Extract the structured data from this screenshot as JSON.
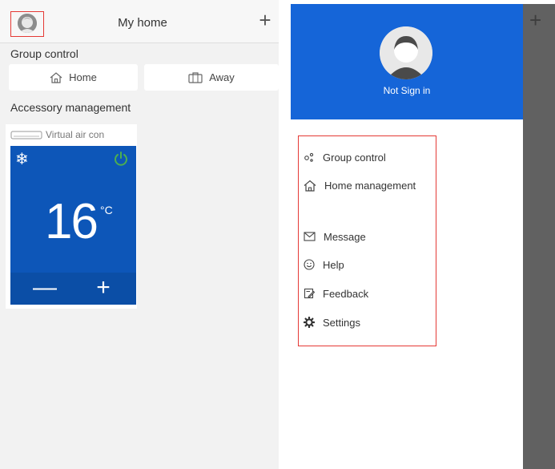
{
  "left_panel": {
    "title": "My home",
    "add_glyph": "+",
    "group_control_label": "Group control",
    "modes": [
      {
        "label": "Home",
        "icon": "home-icon"
      },
      {
        "label": "Away",
        "icon": "suitcase-icon"
      }
    ],
    "accessory_label": "Accessory management",
    "device": {
      "name": "Virtual air con",
      "temperature": "16",
      "unit": "°C",
      "minus": "—",
      "plus": "+",
      "mode_icon": "snowflake-icon",
      "power_icon": "power-icon",
      "power_color": "#4caf50"
    }
  },
  "drawer": {
    "user_status": "Not Sign in",
    "header_color": "#1565d8",
    "menu": [
      {
        "label": "Group control",
        "icon": "group-icon"
      },
      {
        "label": "Home management",
        "icon": "home-outline-icon"
      },
      {
        "label": "Message",
        "icon": "mail-icon"
      },
      {
        "label": "Help",
        "icon": "smiley-icon"
      },
      {
        "label": "Feedback",
        "icon": "feedback-icon"
      },
      {
        "label": "Settings",
        "icon": "gear-icon"
      }
    ]
  },
  "dimmed": {
    "add_glyph": "+"
  },
  "highlight_color": "#e53935"
}
